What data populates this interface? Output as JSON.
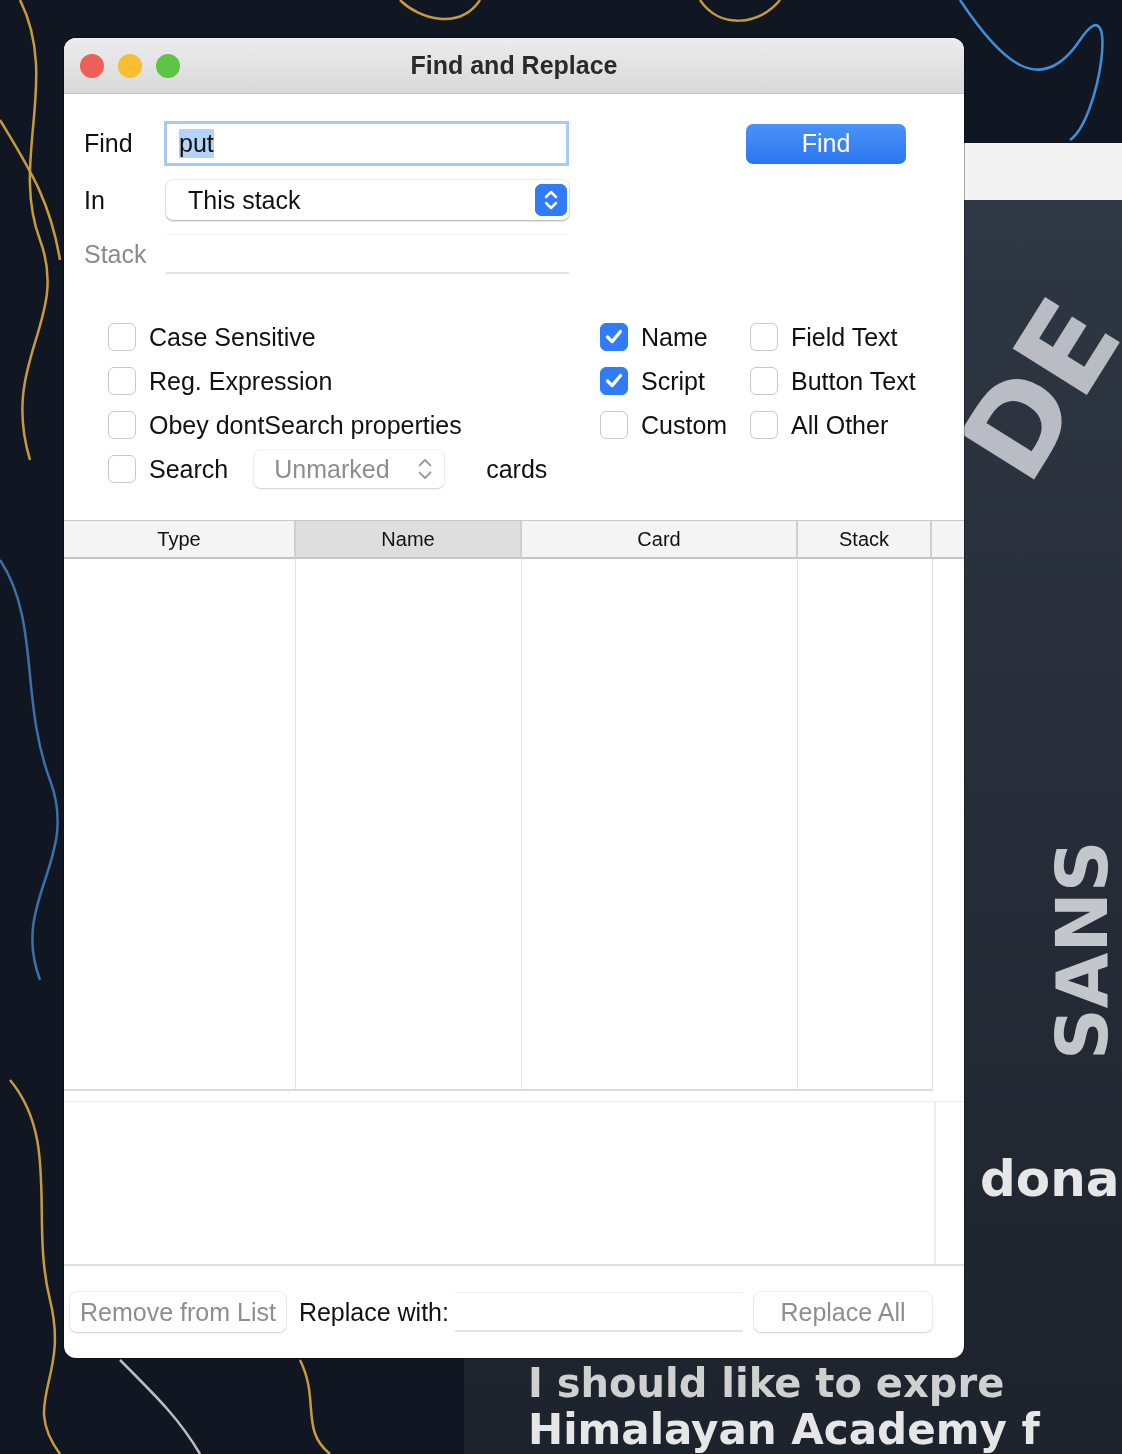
{
  "window": {
    "title": "Find and Replace"
  },
  "find": {
    "label": "Find",
    "value": "put",
    "text_selected": true
  },
  "find_button": {
    "label": "Find"
  },
  "in": {
    "label": "In",
    "value": "This stack"
  },
  "stack": {
    "label": "Stack",
    "disabled": true
  },
  "options": [
    {
      "label": "Case Sensitive",
      "checked": false
    },
    {
      "label": "Reg. Expression",
      "checked": false
    },
    {
      "label": "Obey dontSearch properties",
      "checked": false
    }
  ],
  "search_marked": {
    "label": "Search",
    "checked": false,
    "popup": "Unmarked",
    "popup_disabled": true,
    "suffix": "cards"
  },
  "search_in": [
    {
      "label": "Name",
      "checked": true
    },
    {
      "label": "Field Text",
      "checked": false
    },
    {
      "label": "Script",
      "checked": true
    },
    {
      "label": "Button Text",
      "checked": false
    },
    {
      "label": "Custom",
      "checked": false
    },
    {
      "label": "All Other",
      "checked": false
    }
  ],
  "table": {
    "columns": [
      {
        "label": "Type",
        "selected": false
      },
      {
        "label": "Name",
        "selected": true
      },
      {
        "label": "Card",
        "selected": false
      },
      {
        "label": "Stack",
        "selected": false
      }
    ]
  },
  "footer": {
    "remove_button": {
      "label": "Remove from List",
      "disabled": true
    },
    "replace_label": "Replace with:",
    "replace_all_button": {
      "label": "Replace All",
      "disabled": true
    }
  },
  "background_window": {
    "texts": [
      {
        "kind": "diagonal",
        "text": "DE"
      },
      {
        "kind": "vertical",
        "text": "SANS"
      },
      {
        "kind": "line",
        "text": "dona"
      },
      {
        "kind": "under",
        "text": "I should like to expre"
      },
      {
        "kind": "bottom",
        "text": "Himalayan Academy f"
      }
    ]
  }
}
